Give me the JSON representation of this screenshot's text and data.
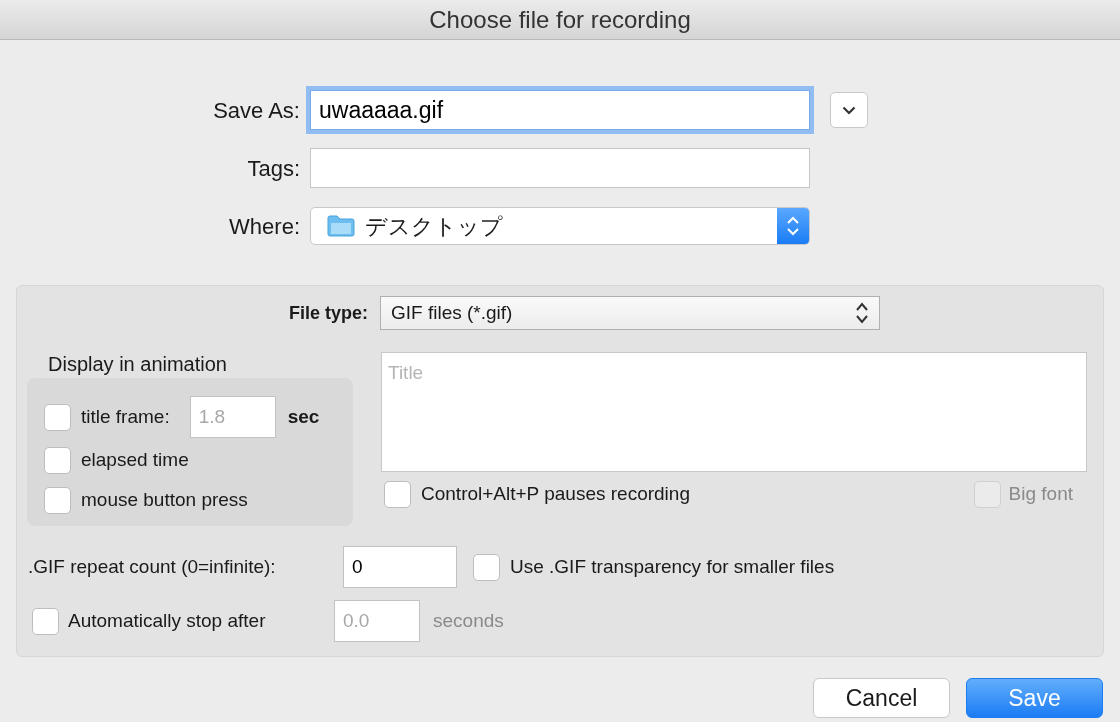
{
  "window": {
    "title": "Choose file for recording"
  },
  "save_as": {
    "label": "Save As:",
    "value": "uwaaaaa.gif",
    "focused": true
  },
  "tags": {
    "label": "Tags:"
  },
  "where": {
    "label": "Where:",
    "value": "デスクトップ"
  },
  "options": {
    "file_type": {
      "label": "File type:",
      "value": "GIF files (*.gif)"
    },
    "display_group": {
      "title": "Display in animation",
      "items": [
        {
          "kind": "field",
          "label": "title frame:",
          "checked": false,
          "value": "1.8",
          "field_disabled": true,
          "unit": "sec"
        },
        {
          "kind": "plain",
          "label": "elapsed time",
          "checked": false
        },
        {
          "kind": "plain",
          "label": "mouse button press",
          "checked": false
        }
      ]
    },
    "title_box": {
      "placeholder": "Title"
    },
    "pause_hotkey": {
      "label": "Control+Alt+P pauses recording",
      "checked": false
    },
    "big_font": {
      "label": "Big font",
      "checked": false,
      "disabled": true
    },
    "repeat_count": {
      "label": ".GIF repeat count (0=infinite):",
      "value": "0"
    },
    "transparency": {
      "label": "Use .GIF transparency for smaller files",
      "checked": false
    },
    "auto_stop": {
      "label": "Automatically stop after",
      "checked": false,
      "value": "0.0",
      "unit": "seconds",
      "disabled": true
    }
  },
  "buttons": [
    {
      "label": "Cancel",
      "kind": "default"
    },
    {
      "label": "Save",
      "kind": "primary"
    }
  ]
}
